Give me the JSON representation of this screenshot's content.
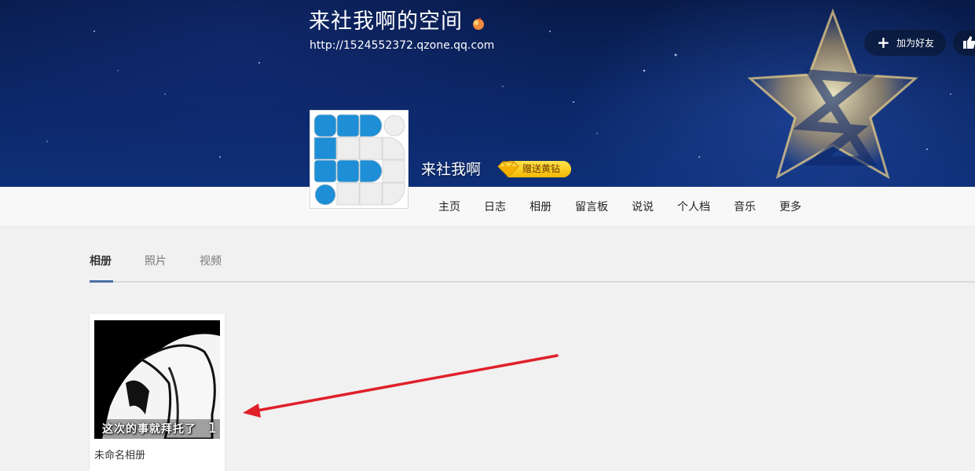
{
  "header": {
    "space_title": "来社我啊的空间",
    "space_url": "http://1524552372.qzone.qq.com",
    "owner_name": "来社我啊",
    "gift_vip_label": "赠送黄钻",
    "add_friend_label": "加为好友"
  },
  "nav": {
    "items": [
      "主页",
      "日志",
      "相册",
      "留言板",
      "说说",
      "个人档",
      "音乐",
      "更多"
    ]
  },
  "tabs": {
    "items": [
      "相册",
      "照片",
      "视频"
    ],
    "active": "相册"
  },
  "albums": [
    {
      "name": "未命名相册",
      "count": "1",
      "cover_caption": "这次的事就拜托了"
    }
  ],
  "colors": {
    "banner": "#0b2767",
    "accent": "#4a6fa5",
    "annotation_arrow": "#e0202a",
    "vip_gold": "#f5b800"
  }
}
